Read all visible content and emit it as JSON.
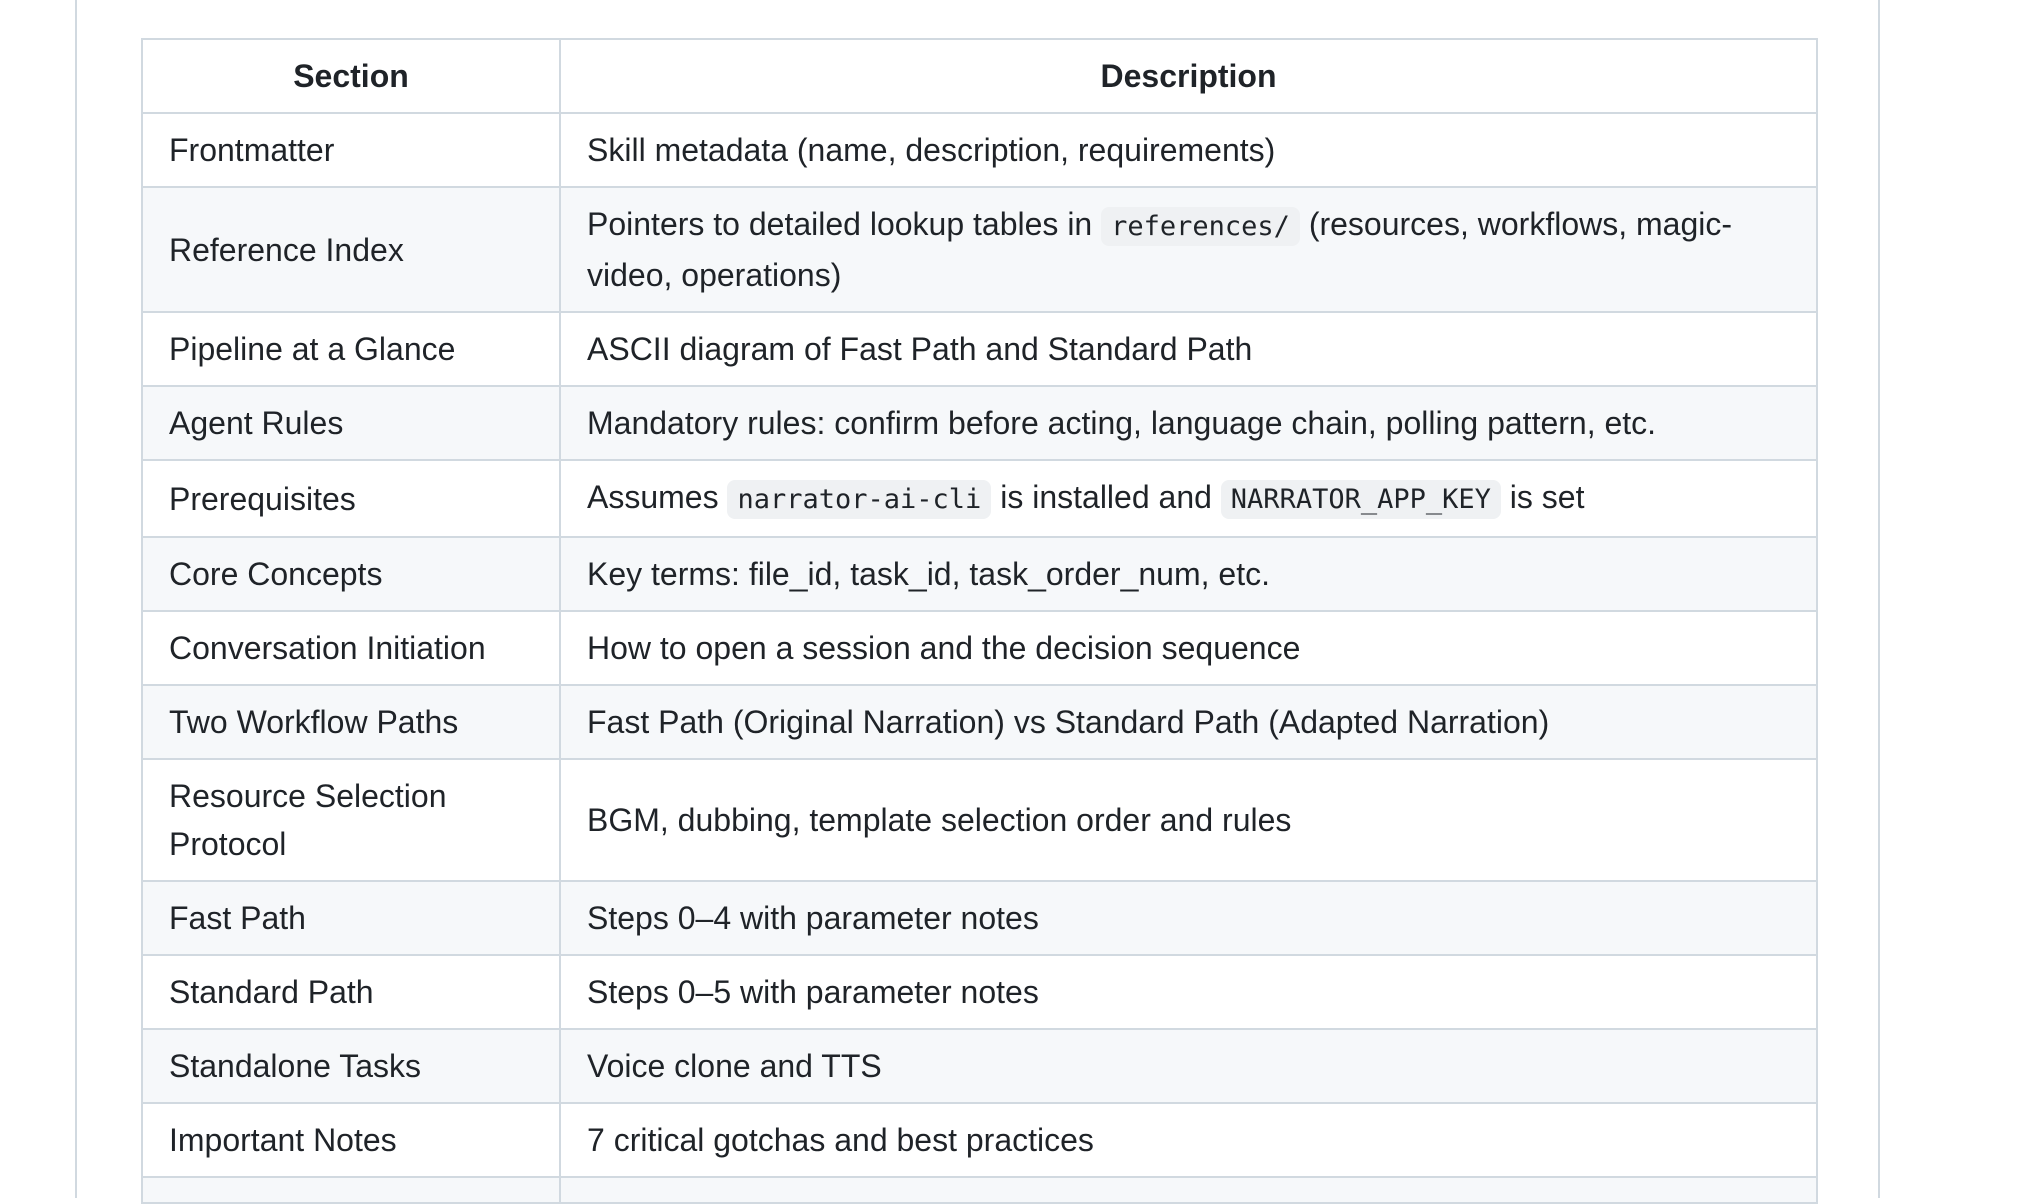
{
  "table": {
    "headers": [
      "Section",
      "Description"
    ],
    "rows": [
      {
        "section": "Frontmatter",
        "desc": [
          {
            "t": "Skill metadata (name, description, requirements)"
          }
        ]
      },
      {
        "section": "Reference Index",
        "desc": [
          {
            "t": "Pointers to detailed lookup tables in "
          },
          {
            "code": "references/"
          },
          {
            "t": " (resources, workflows, magic-video, operations)"
          }
        ]
      },
      {
        "section": "Pipeline at a Glance",
        "desc": [
          {
            "t": "ASCII diagram of Fast Path and Standard Path"
          }
        ]
      },
      {
        "section": "Agent Rules",
        "desc": [
          {
            "t": "Mandatory rules: confirm before acting, language chain, polling pattern, etc."
          }
        ]
      },
      {
        "section": "Prerequisites",
        "desc": [
          {
            "t": "Assumes "
          },
          {
            "code": "narrator-ai-cli"
          },
          {
            "t": " is installed and "
          },
          {
            "code": "NARRATOR_APP_KEY"
          },
          {
            "t": " is set"
          }
        ]
      },
      {
        "section": "Core Concepts",
        "desc": [
          {
            "t": "Key terms: file_id, task_id, task_order_num, etc."
          }
        ]
      },
      {
        "section": "Conversation Initiation",
        "desc": [
          {
            "t": "How to open a session and the decision sequence"
          }
        ]
      },
      {
        "section": "Two Workflow Paths",
        "desc": [
          {
            "t": "Fast Path (Original Narration) vs Standard Path (Adapted Narration)"
          }
        ]
      },
      {
        "section": "Resource Selection Protocol",
        "desc": [
          {
            "t": "BGM, dubbing, template selection order and rules"
          }
        ]
      },
      {
        "section": "Fast Path",
        "desc": [
          {
            "t": "Steps 0–4 with parameter notes"
          }
        ]
      },
      {
        "section": "Standard Path",
        "desc": [
          {
            "t": "Steps 0–5 with parameter notes"
          }
        ]
      },
      {
        "section": "Standalone Tasks",
        "desc": [
          {
            "t": "Voice clone and TTS"
          }
        ]
      },
      {
        "section": "Important Notes",
        "desc": [
          {
            "t": "7 critical gotchas and best practices"
          }
        ]
      },
      {
        "section": "",
        "desc": [
          {
            "t": ""
          }
        ]
      }
    ]
  }
}
